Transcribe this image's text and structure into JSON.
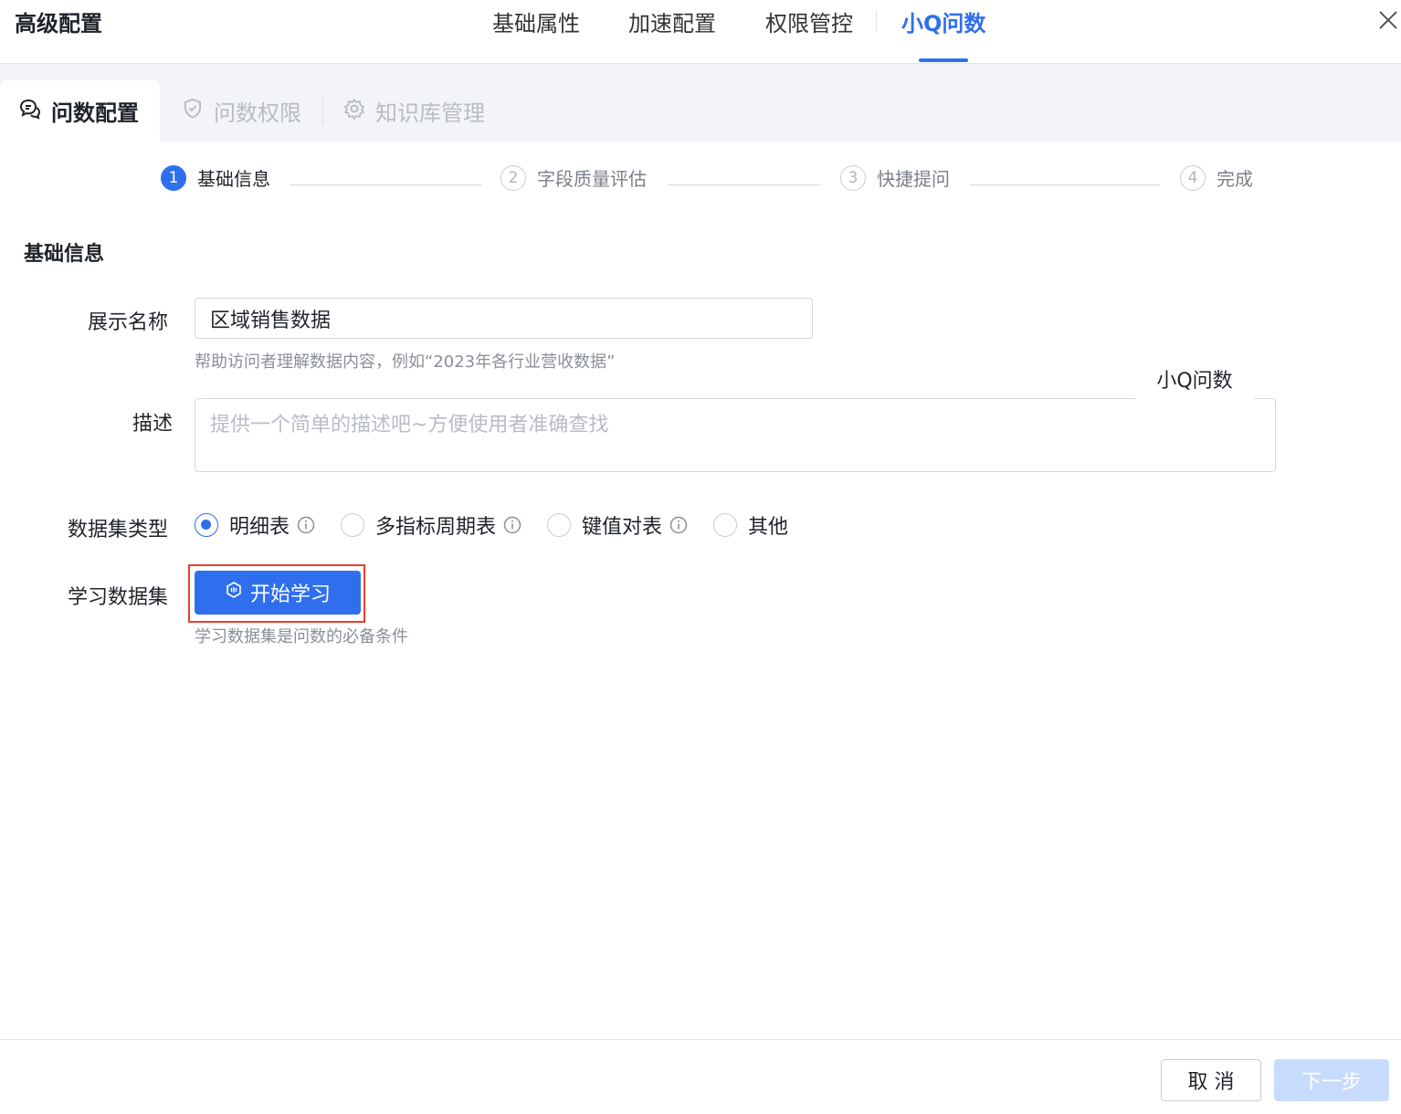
{
  "header": {
    "title": "高级配置",
    "tabs": [
      {
        "label": "基础属性"
      },
      {
        "label": "加速配置"
      },
      {
        "label": "权限管控"
      },
      {
        "label": "小Q问数"
      }
    ],
    "active_tab": "小Q问数",
    "close_icon": "close-icon"
  },
  "subtabs": [
    {
      "label": "问数配置",
      "icon": "chat-bubbles-icon"
    },
    {
      "label": "问数权限",
      "icon": "shield-check-icon"
    },
    {
      "label": "知识库管理",
      "icon": "gear-icon"
    }
  ],
  "steps": [
    {
      "num": "1",
      "label": "基础信息"
    },
    {
      "num": "2",
      "label": "字段质量评估"
    },
    {
      "num": "3",
      "label": "快捷提问"
    },
    {
      "num": "4",
      "label": "完成"
    }
  ],
  "active_step": 1,
  "section_title": "基础信息",
  "form": {
    "display_name_label": "展示名称",
    "display_name_value": "区域销售数据",
    "display_name_hint": "帮助访问者理解数据内容，例如“2023年各行业营收数据”",
    "floating_label": "小Q问数",
    "description_label": "描述",
    "description_placeholder": "提供一个简单的描述吧~方便使用者准确查找",
    "dataset_type_label": "数据集类型",
    "dataset_types": [
      {
        "label": "明细表",
        "checked": true,
        "info": true
      },
      {
        "label": "多指标周期表",
        "checked": false,
        "info": true
      },
      {
        "label": "键值对表",
        "checked": false,
        "info": true
      },
      {
        "label": "其他",
        "checked": false,
        "info": false
      }
    ],
    "learn_label": "学习数据集",
    "learn_button": "开始学习",
    "learn_hint": "学习数据集是问数的必备条件"
  },
  "footer": {
    "cancel": "取 消",
    "next": "下一步"
  },
  "colors": {
    "accent": "#2f6fed",
    "highlight_border": "#e8402a",
    "disabled_button": "#c7dbfc"
  }
}
